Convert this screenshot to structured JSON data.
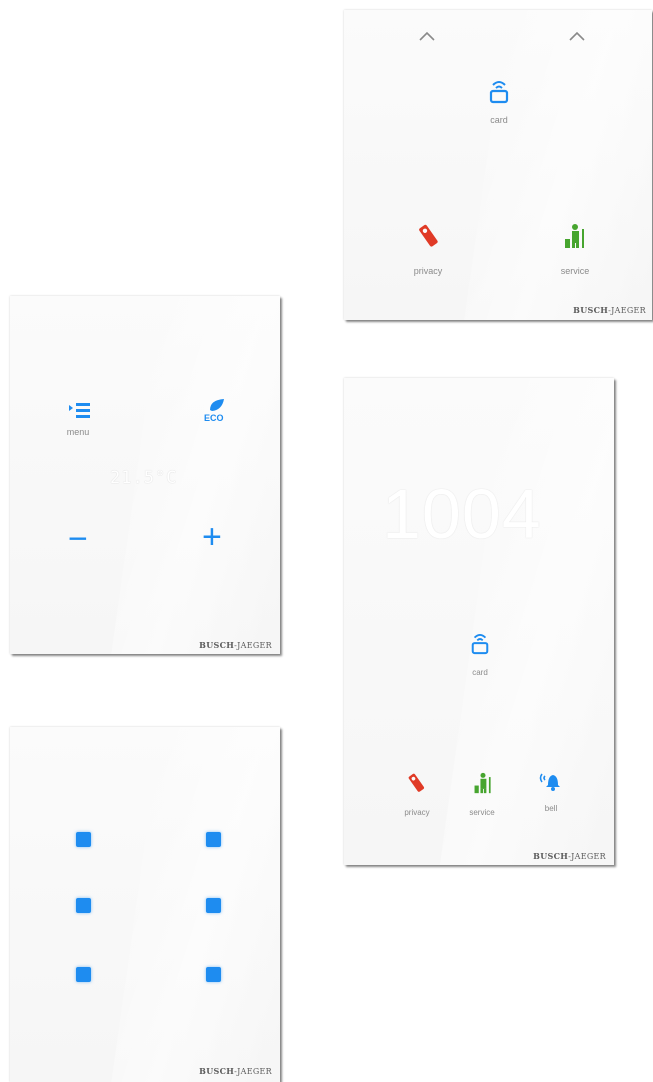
{
  "brand": "BUSCH-JAEGER",
  "brand_parts": {
    "bold": "BUSCH",
    "thin": "-JAEGER"
  },
  "colors": {
    "blue": "#1e8cf0",
    "red": "#e03a26",
    "green": "#47a52f",
    "label_gray": "#8b8b8b"
  },
  "panel_door_top": {
    "icons": [
      "chevron-up-icon",
      "chevron-up-icon",
      "card-reader-icon",
      "privacy-hanger-icon",
      "service-cleaning-icon"
    ],
    "card_label": "card",
    "privacy_label": "privacy",
    "service_label": "service"
  },
  "panel_thermostat": {
    "menu_label": "menu",
    "eco_label": "ECO",
    "temperature": "21.5°C",
    "minus_symbol": "−",
    "plus_symbol": "+"
  },
  "panel_door_number": {
    "room_number": "1004",
    "card_label": "card",
    "privacy_label": "privacy",
    "service_label": "service",
    "bell_label": "bell"
  },
  "panel_switch": {
    "button_count": 6
  }
}
